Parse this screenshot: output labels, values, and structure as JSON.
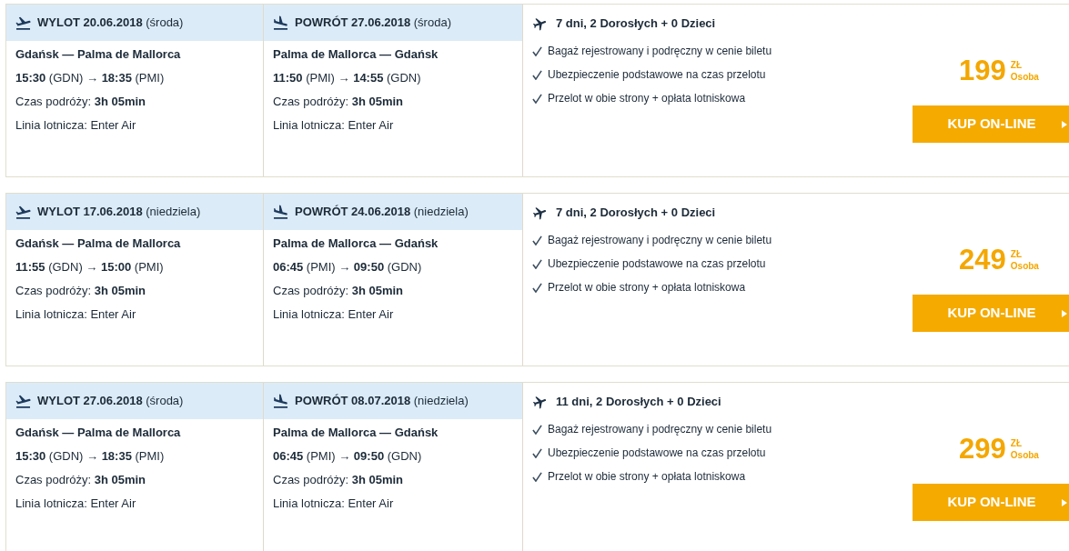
{
  "offers": [
    {
      "legs": [
        {
          "kind": "outbound",
          "header": "**WYLOT 20.06.2018** (środa)",
          "route": "Gdańsk — Palma de Mallorca",
          "times": "**15:30** (GDN) → **18:35** (PMI)",
          "duration": "Czas podróży: **3h 05min**",
          "airline": "Linia lotnicza: Enter Air"
        },
        {
          "kind": "return",
          "header": "**POWRÓT 27.06.2018** (środa)",
          "route": "Palma de Mallorca — Gdańsk",
          "times": "**11:50** (PMI) → **14:55** (GDN)",
          "duration": "Czas podróży: **3h 05min**",
          "airline": "Linia lotnicza: Enter Air"
        }
      ],
      "summary": "7 dni, 2 Dorosłych + 0 Dzieci",
      "features": [
        "Bagaż rejestrowany i podręczny w cenie biletu",
        "Ubezpieczenie podstawowe na czas przelotu",
        "Przelot w obie strony + opłata lotniskowa"
      ],
      "price": "199",
      "currency": "ZŁ",
      "per": "Osoba",
      "button": "KUP ON-LINE"
    },
    {
      "legs": [
        {
          "kind": "outbound",
          "header": "**WYLOT 17.06.2018** (niedziela)",
          "route": "Gdańsk — Palma de Mallorca",
          "times": "**11:55** (GDN) → **15:00** (PMI)",
          "duration": "Czas podróży: **3h 05min**",
          "airline": "Linia lotnicza: Enter Air"
        },
        {
          "kind": "return",
          "header": "**POWRÓT 24.06.2018** (niedziela)",
          "route": "Palma de Mallorca — Gdańsk",
          "times": "**06:45** (PMI) → **09:50** (GDN)",
          "duration": "Czas podróży: **3h 05min**",
          "airline": "Linia lotnicza: Enter Air"
        }
      ],
      "summary": "7 dni, 2 Dorosłych + 0 Dzieci",
      "features": [
        "Bagaż rejestrowany i podręczny w cenie biletu",
        "Ubezpieczenie podstawowe na czas przelotu",
        "Przelot w obie strony + opłata lotniskowa"
      ],
      "price": "249",
      "currency": "ZŁ",
      "per": "Osoba",
      "button": "KUP ON-LINE"
    },
    {
      "legs": [
        {
          "kind": "outbound",
          "header": "**WYLOT 27.06.2018** (środa)",
          "route": "Gdańsk — Palma de Mallorca",
          "times": "**15:30** (GDN) → **18:35** (PMI)",
          "duration": "Czas podróży: **3h 05min**",
          "airline": "Linia lotnicza: Enter Air"
        },
        {
          "kind": "return",
          "header": "**POWRÓT 08.07.2018** (niedziela)",
          "route": "Palma de Mallorca — Gdańsk",
          "times": "**06:45** (PMI) → **09:50** (GDN)",
          "duration": "Czas podróży: **3h 05min**",
          "airline": "Linia lotnicza: Enter Air"
        }
      ],
      "summary": "11 dni, 2 Dorosłych + 0 Dzieci",
      "features": [
        "Bagaż rejestrowany i podręczny w cenie biletu",
        "Ubezpieczenie podstawowe na czas przelotu",
        "Przelot w obie strony + opłata lotniskowa"
      ],
      "price": "299",
      "currency": "ZŁ",
      "per": "Osoba",
      "button": "KUP ON-LINE"
    }
  ]
}
